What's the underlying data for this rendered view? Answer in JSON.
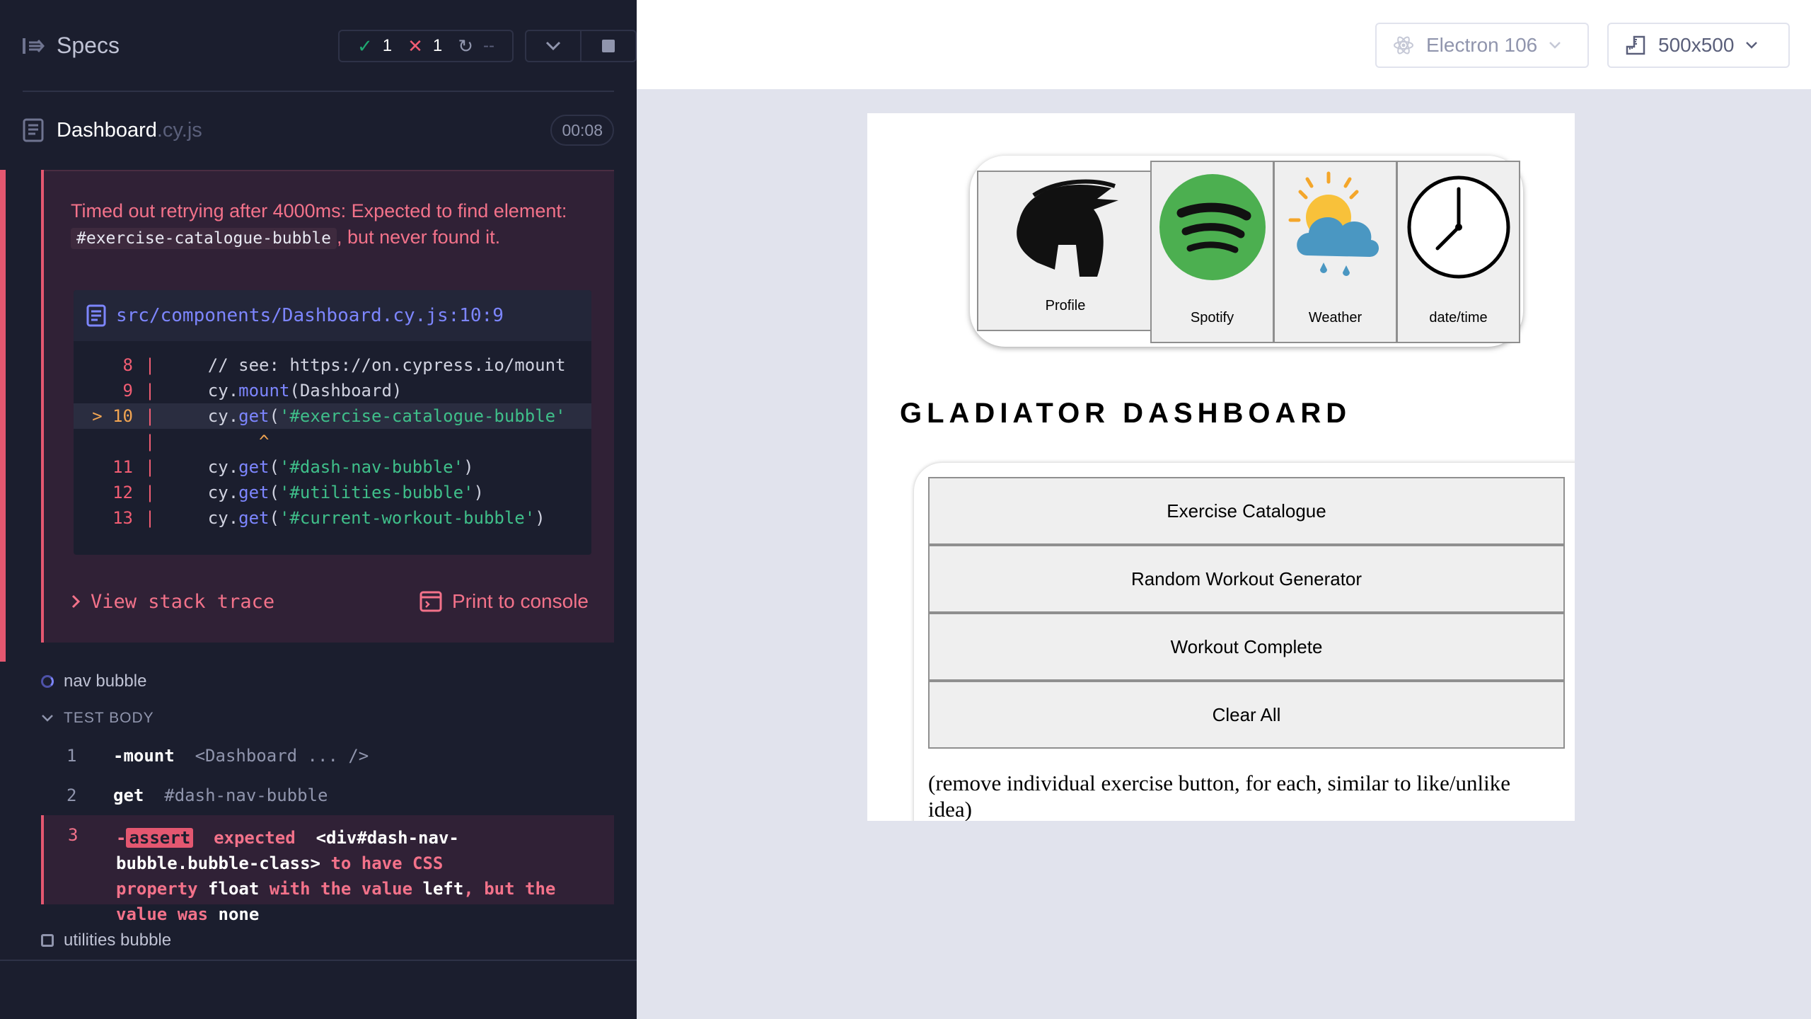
{
  "reporter": {
    "specs_label": "Specs",
    "stats": {
      "passed": "1",
      "failed": "1",
      "pending": "--"
    },
    "spec_file": {
      "name": "Dashboard",
      "ext": ".cy.js",
      "duration": "00:08"
    },
    "error": {
      "message_pre": "Timed out retrying after 4000ms: Expected to find element: ",
      "selector": "#exercise-catalogue-bubble",
      "message_post": ", but never found it.",
      "file": "src/components/Dashboard.cy.js:10:9",
      "code_lines": [
        {
          "num": "8",
          "marker": "",
          "text": "    // see: https://on.cypress.io/mount"
        },
        {
          "num": "9",
          "marker": "",
          "text": "    cy.mount(Dashboard)"
        },
        {
          "num": "10",
          "marker": ">",
          "text": "    cy.get('#exercise-catalogue-bubble'"
        },
        {
          "num": "",
          "marker": "",
          "text": "         ^"
        },
        {
          "num": "11",
          "marker": "",
          "text": "    cy.get('#dash-nav-bubble')"
        },
        {
          "num": "12",
          "marker": "",
          "text": "    cy.get('#utilities-bubble')"
        },
        {
          "num": "13",
          "marker": "",
          "text": "    cy.get('#current-workout-bubble')"
        }
      ],
      "view_stack": "View stack trace",
      "print_console": "Print to console"
    },
    "tests": {
      "nav_bubble": "nav bubble",
      "test_body": "TEST BODY",
      "commands": [
        {
          "idx": "1",
          "name": "-mount",
          "arg": "<Dashboard ... />"
        },
        {
          "idx": "2",
          "name": "get",
          "arg": "#dash-nav-bubble"
        },
        {
          "idx": "3",
          "name": "assert",
          "prefix": "-",
          "expected": "expected",
          "subject": "<div#dash-nav-bubble.bubble-class>",
          "t1": "to have CSS property",
          "prop": "float",
          "t2": "with the value",
          "val": "left",
          "t3": ", but the value was",
          "actual": "none"
        }
      ],
      "utilities_bubble": "utilities bubble"
    }
  },
  "aut_toolbar": {
    "browser": "Electron 106",
    "viewport": "500x500"
  },
  "app": {
    "nav_buttons": [
      {
        "label": "Profile"
      },
      {
        "label": "Spotify"
      },
      {
        "label": "Weather"
      },
      {
        "label": "date/time"
      }
    ],
    "title": "GLADIATOR DASHBOARD",
    "exercise_buttons": [
      "Exercise Catalogue",
      "Random Workout Generator",
      "Workout Complete",
      "Clear All"
    ],
    "note": "(remove individual exercise button, for each, similar to like/unlike idea)"
  },
  "colors": {
    "accent": "#7d86ff",
    "fail": "#e45770",
    "pass": "#1fa971",
    "panel": "#1b1e2e"
  },
  "icons": [
    "specs-menu-icon",
    "check-icon",
    "x-icon",
    "pending-icon",
    "chevron-down-icon",
    "stop-icon",
    "document-icon",
    "electron-icon",
    "ruler-icon",
    "spartan-helmet-icon",
    "spotify-icon",
    "weather-icon",
    "clock-icon",
    "console-icon"
  ]
}
